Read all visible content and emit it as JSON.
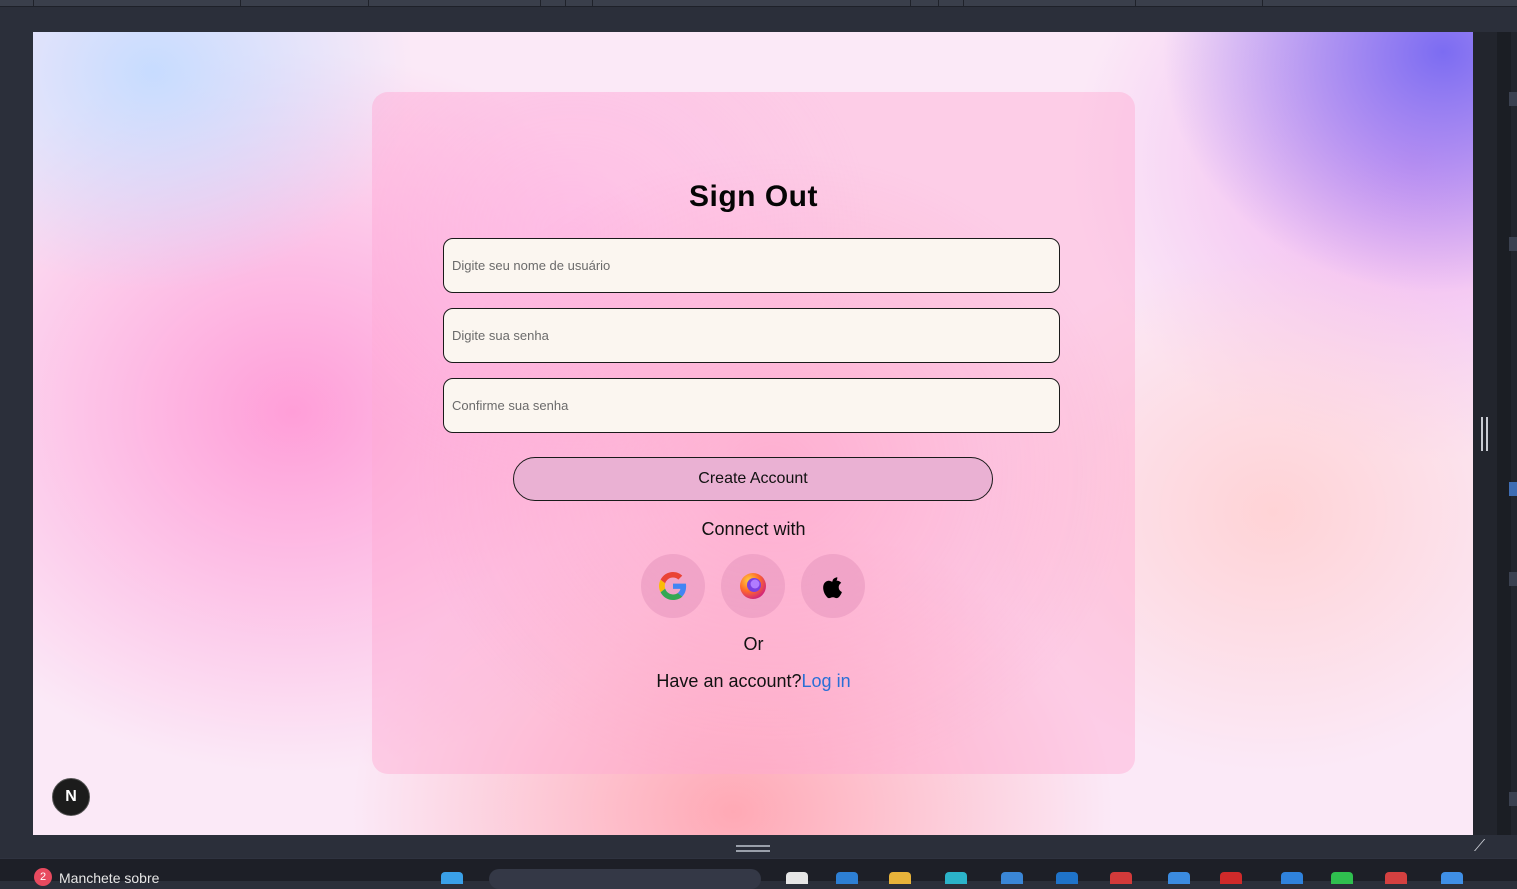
{
  "page": {
    "title": "Sign Out",
    "fields": [
      {
        "name": "username",
        "placeholder": "Digite seu nome de usuário",
        "value": ""
      },
      {
        "name": "password",
        "placeholder": "Digite sua senha",
        "value": ""
      },
      {
        "name": "confirm_password",
        "placeholder": "Confirme sua senha",
        "value": ""
      }
    ],
    "create_button": "Create Account",
    "connect_label": "Connect with",
    "social": [
      "google-icon",
      "firefox-icon",
      "apple-icon"
    ],
    "or_label": "Or",
    "have_account": "Have an account?",
    "login_link": "Log in",
    "badge": "N"
  },
  "taskbar": {
    "notification_count": "2",
    "window_title": "Manchete sobre"
  },
  "colors": {
    "card": "#f7a3c8",
    "field_bg": "#fbf6f0",
    "button_bg": "#eab1d3",
    "link": "#2a6fd6"
  }
}
